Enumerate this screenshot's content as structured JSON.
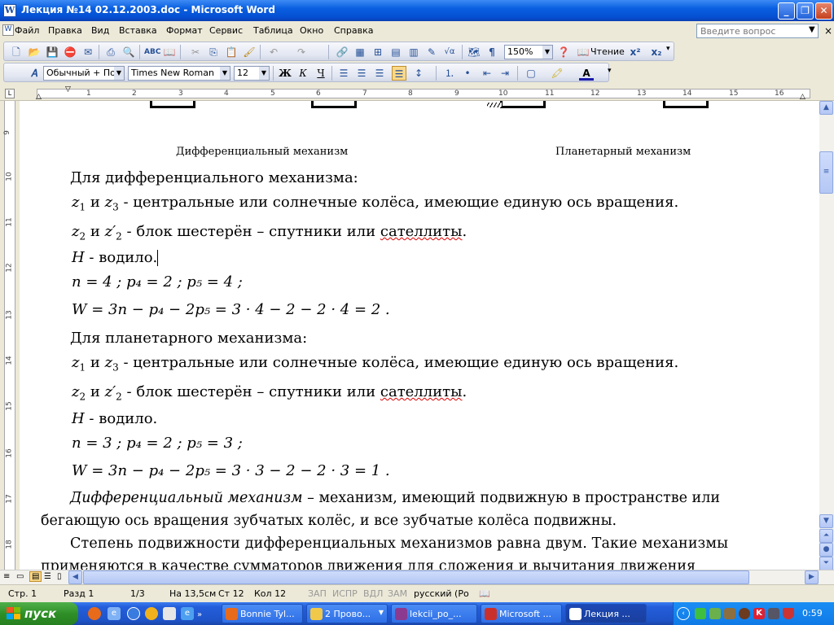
{
  "window": {
    "title": "Лекция №14 02.12.2003.doc - Microsoft Word",
    "app_icon": "W"
  },
  "menu": {
    "items": [
      "Файл",
      "Правка",
      "Вид",
      "Вставка",
      "Формат",
      "Сервис",
      "Таблица",
      "Окно",
      "Справка"
    ],
    "help_placeholder": "Введите вопрос"
  },
  "toolbar_standard": {
    "zoom": "150%",
    "read_label": "Чтение"
  },
  "toolbar_format": {
    "style": "Обычный + По ц",
    "font": "Times New Roman",
    "size": "12",
    "bold": "Ж",
    "italic": "К",
    "underline": "Ч"
  },
  "ruler": {
    "numbers": [
      "1",
      "2",
      "3",
      "4",
      "5",
      "6",
      "7",
      "8",
      "9",
      "10",
      "11",
      "12",
      "13",
      "14",
      "15",
      "16"
    ],
    "vnumbers": [
      "9",
      "10",
      "11",
      "12",
      "13",
      "14",
      "15",
      "16",
      "17",
      "18"
    ]
  },
  "document": {
    "caption_left": "Дифференциальный механизм",
    "caption_right": "Планетарный механизм",
    "diff_heading": "Для дифференциального механизма:",
    "and": "и",
    "z1": "z",
    "z1_sub": "1",
    "z3": "z",
    "z3_sub": "3",
    "z2": "z",
    "z2_sub": "2",
    "z2p": "z′",
    "z2p_sub": "2",
    "central_wheels": "- центральные или солнечные колёса, имеющие единую ось вращения.",
    "block_text": "- блок шестерён – спутники или ",
    "satellites": "сателлиты",
    "period": ".",
    "H": "H",
    "carrier": " - водило.",
    "diff_params": "n = 4 ;  p₄ = 2 ;  p₅ = 4 ;",
    "diff_formula": "W = 3n − p₄ − 2p₅ = 3 · 4 − 2 − 2 · 4 = 2 .",
    "plan_heading": "Для планетарного механизма:",
    "plan_params": "n = 3 ;  p₄ = 2 ;  p₅ = 3 ;",
    "plan_formula": "W = 3n − p₄ − 2p₅ = 3 · 3 − 2 − 2 · 3 = 1 .",
    "def_term": "Дифференциальный механизм",
    "def_line1": " – механизм, имеющий подвижную в пространстве или",
    "def_line2": "бегающую ось вращения зубчатых колёс, и все зубчатые колёса подвижны.",
    "mob_line1": "Степень подвижности дифференциальных механизмов равна двум. Такие механизмы",
    "mob_line2": "применяются в качестве сумматоров движения для сложения и вычитания движения"
  },
  "status": {
    "page": "Стр. 1",
    "section": "Разд 1",
    "pages": "1/3",
    "at": "На 13,5см",
    "line": "Ст 12",
    "col": "Кол 12",
    "rec": "ЗАП",
    "trk": "ИСПР",
    "ext": "ВДЛ",
    "ovr": "ЗАМ",
    "lang": "русский (Ро"
  },
  "taskbar": {
    "start": "пуск",
    "tasks": [
      "Bonnie Tyl...",
      "2 Прово...",
      "lekcii_po_...",
      "Microsoft ...",
      "Лекция ..."
    ],
    "clock": "0:59"
  },
  "colors": {
    "titlebar": "#0a5fe0",
    "taskbar": "#245edb",
    "start": "#2f8f27",
    "spellcheck": "#d00000"
  }
}
